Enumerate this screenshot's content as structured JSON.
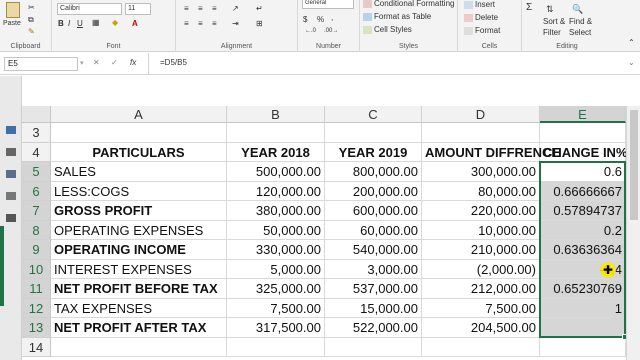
{
  "ribbon": {
    "clipboard": {
      "paste_label": "Paste",
      "group_label": "Clipboard"
    },
    "font": {
      "name": "Calibri",
      "size": "11",
      "bold": "B",
      "italic": "I",
      "underline": "U",
      "font_color_glyph": "A",
      "group_label": "Font"
    },
    "alignment": {
      "group_label": "Alignment"
    },
    "number": {
      "format": "General",
      "currency": "$",
      "percent": "%",
      "comma": ",",
      "group_label": "Number"
    },
    "styles": {
      "conditional": "Conditional Formatting",
      "format_table": "Format as Table",
      "cell_styles": "Cell Styles",
      "group_label": "Styles"
    },
    "cells": {
      "insert": "Insert",
      "delete": "Delete",
      "format": "Format",
      "group_label": "Cells"
    },
    "editing": {
      "sum": "Σ",
      "sort": "Sort &",
      "filter": "Filter",
      "find": "Find &",
      "select": "Select",
      "group_label": "Editing"
    }
  },
  "formula_bar": {
    "name_box": "E5",
    "cancel": "✕",
    "enter": "✓",
    "fx": "fx",
    "formula": "=D5/B5"
  },
  "columns": [
    "A",
    "B",
    "C",
    "D",
    "E"
  ],
  "rows": [
    {
      "num": "3",
      "cells": [
        "",
        "",
        "",
        "",
        ""
      ]
    },
    {
      "num": "4",
      "cells": [
        "PARTICULARS",
        "YEAR 2018",
        "YEAR 2019",
        "AMOUNT DIFFRENCE",
        "CHANGE IN%"
      ]
    },
    {
      "num": "5",
      "cells": [
        "SALES",
        "500,000.00",
        "800,000.00",
        "300,000.00",
        "0.6"
      ]
    },
    {
      "num": "6",
      "cells": [
        "LESS:COGS",
        "120,000.00",
        "200,000.00",
        "80,000.00",
        "0.66666667"
      ]
    },
    {
      "num": "7",
      "cells": [
        "GROSS PROFIT",
        "380,000.00",
        "600,000.00",
        "220,000.00",
        "0.57894737"
      ]
    },
    {
      "num": "8",
      "cells": [
        "OPERATING EXPENSES",
        "50,000.00",
        "60,000.00",
        "10,000.00",
        "0.2"
      ]
    },
    {
      "num": "9",
      "cells": [
        "OPERATING INCOME",
        "330,000.00",
        "540,000.00",
        "210,000.00",
        "0.63636364"
      ]
    },
    {
      "num": "10",
      "cells": [
        "INTEREST EXPENSES",
        "5,000.00",
        "3,000.00",
        "(2,000.00)",
        "-0.4"
      ]
    },
    {
      "num": "11",
      "cells": [
        "NET PROFIT BEFORE TAX",
        "325,000.00",
        "537,000.00",
        "212,000.00",
        "0.65230769"
      ]
    },
    {
      "num": "12",
      "cells": [
        "TAX EXPENSES",
        "7,500.00",
        "15,000.00",
        "7,500.00",
        "1"
      ]
    },
    {
      "num": "13",
      "cells": [
        "NET PROFIT AFTER TAX",
        "317,500.00",
        "522,000.00",
        "204,500.00",
        ""
      ]
    },
    {
      "num": "14",
      "cells": [
        "",
        "",
        "",
        "",
        ""
      ]
    }
  ],
  "colors": {
    "excel_green": "#217346",
    "selection_fill": "#d6d6d6"
  }
}
